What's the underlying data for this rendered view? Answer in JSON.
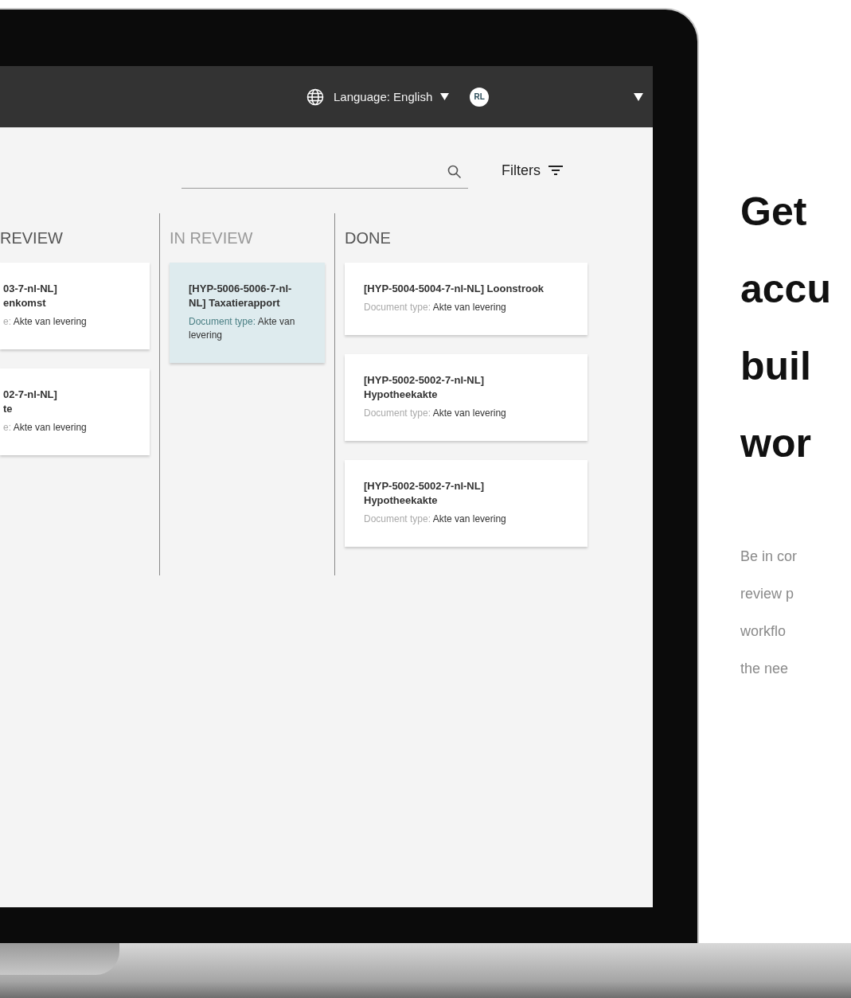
{
  "header": {
    "language": "Language: English",
    "avatar": "RL"
  },
  "filters": "Filters",
  "columns": [
    {
      "title": "REVIEW",
      "dimmed": false,
      "cards": [
        {
          "title": "03-7-nl-NL]\nenkomst",
          "type_label": "e:",
          "type_value": "Akte van levering",
          "selected": false
        },
        {
          "title": "02-7-nl-NL]\nte",
          "type_label": "e:",
          "type_value": "Akte van levering",
          "selected": false
        }
      ]
    },
    {
      "title": "IN REVIEW",
      "dimmed": true,
      "cards": [
        {
          "title": "[HYP-5006-5006-7-nl-\nNL] Taxatierapport",
          "type_label": "Document type:",
          "type_value": "Akte van levering",
          "selected": true
        }
      ]
    },
    {
      "title": "DONE",
      "dimmed": false,
      "cards": [
        {
          "title": "[HYP-5004-5004-7-nl-NL] Loonstrook",
          "type_label": "Document type:",
          "type_value": "Akte van levering",
          "selected": false
        },
        {
          "title": "[HYP-5002-5002-7-nl-NL]\nHypotheekakte",
          "type_label": "Document type:",
          "type_value": "Akte van levering",
          "selected": false
        },
        {
          "title": "[HYP-5002-5002-7-nl-NL]\nHypotheekakte",
          "type_label": "Document type:",
          "type_value": "Akte van levering",
          "selected": false
        }
      ]
    }
  ],
  "promo": {
    "heading_lines": [
      "Get",
      "accu",
      "buil",
      "wor"
    ],
    "body_lines": [
      "Be in cor",
      "review p",
      "workflo",
      "the nee"
    ]
  }
}
